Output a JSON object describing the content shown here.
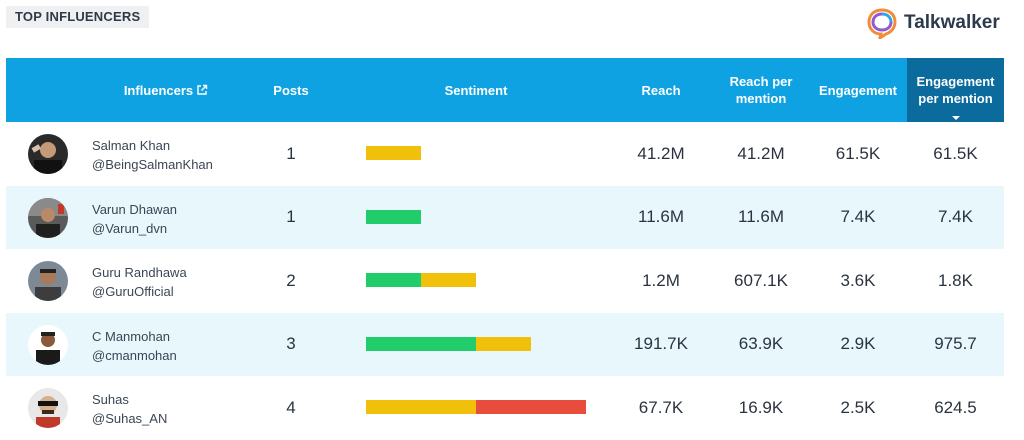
{
  "header": {
    "title": "TOP INFLUENCERS",
    "brand": "Talkwalker"
  },
  "columns": {
    "influencers": "Influencers",
    "posts": "Posts",
    "sentiment": "Sentiment",
    "reach": "Reach",
    "reach_per_mention_1": "Reach per",
    "reach_per_mention_2": "mention",
    "engagement": "Engagement",
    "engagement_per_mention_1": "Engagement",
    "engagement_per_mention_2": "per mention"
  },
  "colors": {
    "header_bg": "#0ea2e3",
    "active_header_bg": "#0a6b9c",
    "positive": "#21cc6a",
    "neutral": "#f0c00a",
    "negative": "#e74c3c",
    "row_alt": "#e7f7fc"
  },
  "rows": [
    {
      "name": "Salman Khan",
      "handle": "@BeingSalmanKhan",
      "posts": "1",
      "sentiment": {
        "positive": 0,
        "neutral": 1,
        "negative": 0
      },
      "reach": "41.2M",
      "reach_per_mention": "41.2M",
      "engagement": "61.5K",
      "engagement_per_mention": "61.5K"
    },
    {
      "name": "Varun Dhawan",
      "handle": "@Varun_dvn",
      "posts": "1",
      "sentiment": {
        "positive": 1,
        "neutral": 0,
        "negative": 0
      },
      "reach": "11.6M",
      "reach_per_mention": "11.6M",
      "engagement": "7.4K",
      "engagement_per_mention": "7.4K"
    },
    {
      "name": "Guru Randhawa",
      "handle": "@GuruOfficial",
      "posts": "2",
      "sentiment": {
        "positive": 1,
        "neutral": 1,
        "negative": 0
      },
      "reach": "1.2M",
      "reach_per_mention": "607.1K",
      "engagement": "3.6K",
      "engagement_per_mention": "1.8K"
    },
    {
      "name": "C Manmohan",
      "handle": "@cmanmohan",
      "posts": "3",
      "sentiment": {
        "positive": 2,
        "neutral": 1,
        "negative": 0
      },
      "reach": "191.7K",
      "reach_per_mention": "63.9K",
      "engagement": "2.9K",
      "engagement_per_mention": "975.7"
    },
    {
      "name": "Suhas",
      "handle": "@Suhas_AN",
      "posts": "4",
      "sentiment": {
        "positive": 0,
        "neutral": 2,
        "negative": 2
      },
      "reach": "67.7K",
      "reach_per_mention": "16.9K",
      "engagement": "2.5K",
      "engagement_per_mention": "624.5"
    }
  ]
}
